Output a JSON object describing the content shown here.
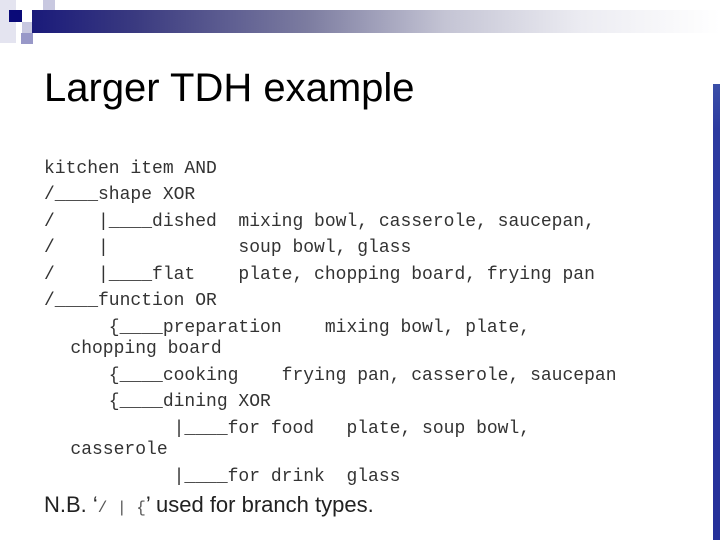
{
  "slide": {
    "title": "Larger TDH example",
    "lines": [
      "kitchen item AND",
      "/____shape XOR",
      "/    |____dished  mixing bowl, casserole, saucepan,",
      "/    |            soup bowl, glass",
      "/    |____flat    plate, chopping board, frying pan",
      "/____function OR",
      "      {____preparation    mixing bowl, plate,",
      "   chopping board",
      "      {____cooking    frying pan, casserole, saucepan",
      "      {____dining XOR",
      "            |____for food   plate, soup bowl,",
      "   casserole",
      "            |____for drink  glass"
    ],
    "note": {
      "prefix": "N.B. ‘",
      "symbols": "/ | {",
      "suffix": "’ used for branch types."
    }
  },
  "colors": {
    "accent_dark": "#1a1a7a",
    "accent_mid": "#9a9acc",
    "accent_light": "#d0d0e8",
    "sidebar": "#25309a"
  }
}
